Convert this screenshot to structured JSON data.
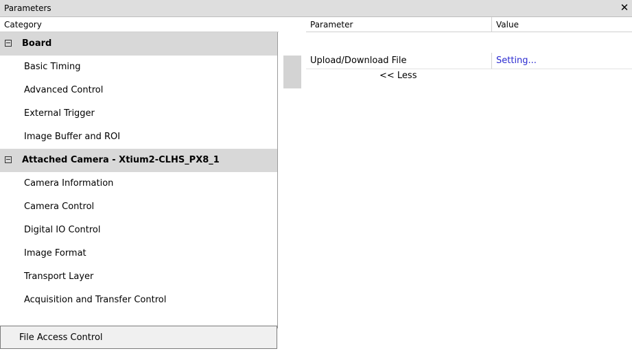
{
  "window": {
    "title": "Parameters",
    "close_glyph": "✕"
  },
  "headers": {
    "category": "Category",
    "parameter": "Parameter",
    "value": "Value"
  },
  "categories": [
    {
      "label": "Board",
      "type": "group"
    },
    {
      "label": "Basic Timing",
      "type": "item"
    },
    {
      "label": "Advanced Control",
      "type": "item"
    },
    {
      "label": "External Trigger",
      "type": "item"
    },
    {
      "label": "Image Buffer and ROI",
      "type": "item"
    },
    {
      "label": "Attached Camera - Xtium2-CLHS_PX8_1",
      "type": "group"
    },
    {
      "label": "Camera Information",
      "type": "item"
    },
    {
      "label": "Camera Control",
      "type": "item"
    },
    {
      "label": "Digital IO Control",
      "type": "item"
    },
    {
      "label": "Image Format",
      "type": "item"
    },
    {
      "label": "Transport Layer",
      "type": "item"
    },
    {
      "label": "Acquisition and Transfer Control",
      "type": "item"
    },
    {
      "label": "File Access Control",
      "type": "item",
      "selected": true
    }
  ],
  "parameters": [
    {
      "name": "Upload/Download File",
      "value": "Setting..."
    }
  ],
  "less_label": "<< Less",
  "colors": {
    "group_bg": "#d8d8d8",
    "link_value": "#2a2ad0"
  }
}
